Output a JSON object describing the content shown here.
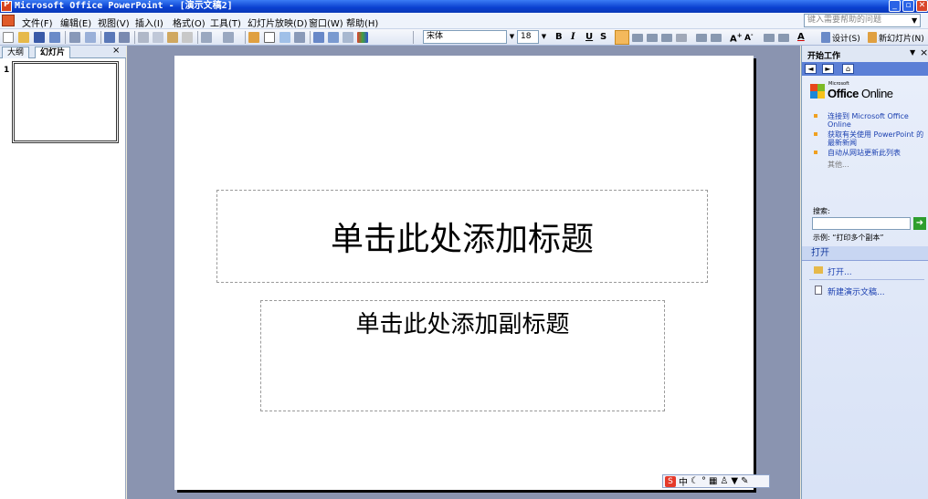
{
  "window": {
    "title": "Microsoft Office PowerPoint - [演示文稿2]",
    "buttons": {
      "minimize": "_",
      "maximize": "▫",
      "close": "✕"
    }
  },
  "menu": {
    "items": [
      "文件(F)",
      "编辑(E)",
      "视图(V)",
      "插入(I)",
      "格式(O)",
      "工具(T)",
      "幻灯片放映(D)",
      "窗口(W)",
      "帮助(H)"
    ],
    "help_placeholder": "键入需要帮助的问题"
  },
  "toolbar": {
    "font_name": "宋体",
    "font_size": "18",
    "bold": "B",
    "italic": "I",
    "underline": "U",
    "shadow": "S",
    "design_label": "设计(S)",
    "new_slide_label": "新幻灯片(N)"
  },
  "left_pane": {
    "tabs": [
      "大纲",
      "幻灯片"
    ],
    "active_tab": "幻灯片",
    "close": "×",
    "slide_number": "1"
  },
  "slide": {
    "title_placeholder": "单击此处添加标题",
    "subtitle_placeholder": "单击此处添加副标题"
  },
  "ime_bar": {
    "logo": "S",
    "mode": "中"
  },
  "task_pane": {
    "title": "开始工作",
    "close": "×",
    "logo_small": "Microsoft",
    "logo_office": "Office",
    "logo_online": " Online",
    "links": [
      "连接到 Microsoft Office Online",
      "获取有关使用 PowerPoint 的最新新闻",
      "自动从网站更新此列表"
    ],
    "more": "其他...",
    "search_label": "搜索:",
    "example": "示例: “打印多个副本”",
    "section_open": "打开",
    "open_link": "打开...",
    "new_presentation": "新建演示文稿..."
  },
  "colors": {
    "titlebar": "#0a3fd0",
    "taskpane_link": "#1a3fb0",
    "workspace": "#8a94b0"
  }
}
